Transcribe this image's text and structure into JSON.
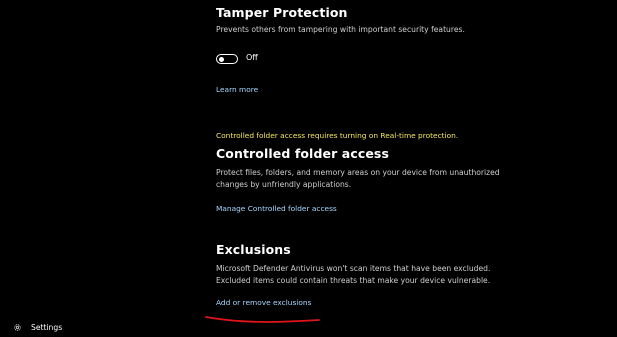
{
  "tamper": {
    "title": "Tamper Protection",
    "description": "Prevents others from tampering with important security features.",
    "toggle_state": "Off",
    "learn_more": "Learn more"
  },
  "cfa": {
    "warning": "Controlled folder access requires turning on Real-time protection.",
    "title": "Controlled folder access",
    "description": "Protect files, folders, and memory areas on your device from unauthorized changes by unfriendly applications.",
    "manage_link": "Manage Controlled folder access"
  },
  "exclusions": {
    "title": "Exclusions",
    "description": "Microsoft Defender Antivirus won't scan items that have been excluded. Excluded items could contain threats that make your device vulnerable.",
    "link": "Add or remove exclusions"
  },
  "sidebar": {
    "settings_label": "Settings",
    "settings_icon": "gear-icon"
  },
  "colors": {
    "background": "#000000",
    "link": "#a6d8ff",
    "warning": "#f6e75c",
    "annotation": "#e0141b"
  }
}
